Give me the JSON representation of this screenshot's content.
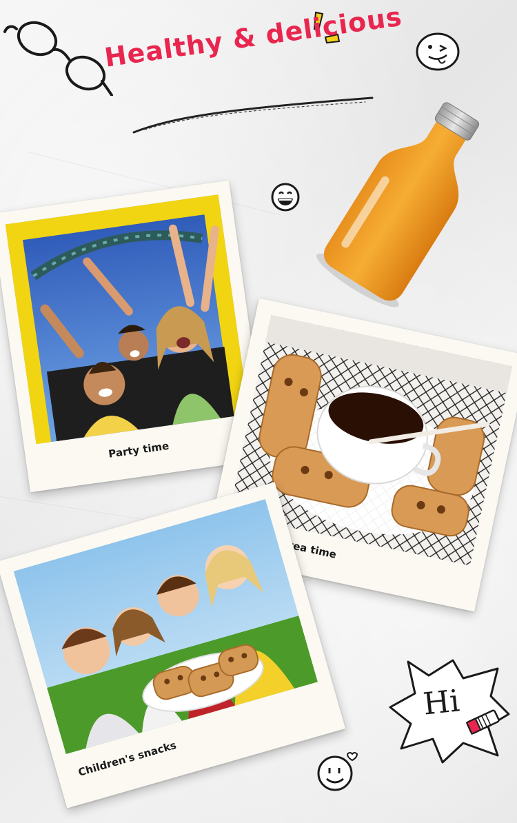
{
  "headline": "Healthy & delicious",
  "photos": [
    {
      "caption": "Party time",
      "scene": "roller-coaster-riders"
    },
    {
      "caption": "Afternoon tea time",
      "scene": "coffee-and-biscuits"
    },
    {
      "caption": "Children's snacks",
      "scene": "kids-with-biscuits"
    }
  ],
  "hi_bubble": "Hi",
  "colors": {
    "headline": "#e8264f",
    "juice": "#f2a12a",
    "polaroid": "#fbf9f2"
  }
}
